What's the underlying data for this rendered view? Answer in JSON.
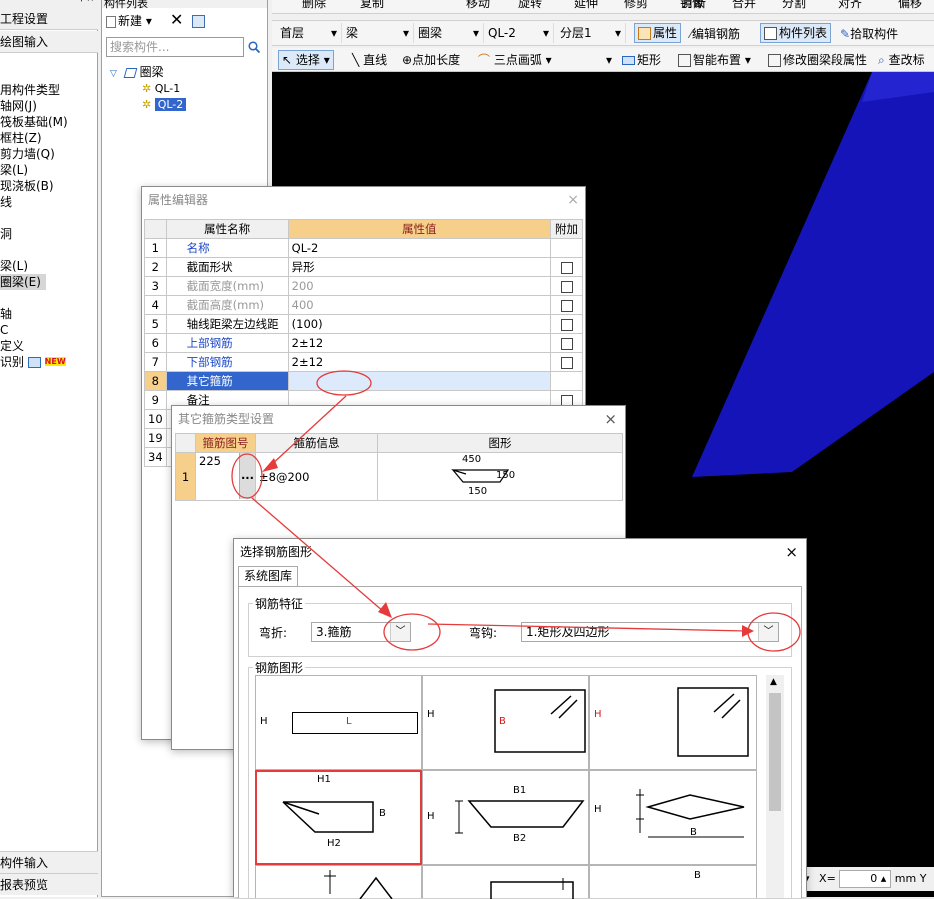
{
  "left_nav": {
    "pin_glyphs": "† ×",
    "items": [
      "工程设置",
      "绘图输入"
    ],
    "tree": [
      "用构件类型",
      "轴网(J)",
      "筏板基础(M)",
      "框柱(Z)",
      "剪力墙(Q)",
      "梁(L)",
      "现浇板(B)",
      "线",
      "",
      "洞",
      "",
      "梁(L)",
      "圈梁(E)",
      "",
      "轴",
      "C",
      "定义",
      "识别"
    ],
    "new_badge": "NEW",
    "bottom": [
      "构件输入",
      "报表预览"
    ]
  },
  "component_list": {
    "title": "构件列表",
    "new_label": "新建",
    "search_placeholder": "搜索构件...",
    "root": "圈梁",
    "children": [
      "QL-1",
      "QL-2"
    ]
  },
  "toolbar1": {
    "items": [
      "删除",
      "复制",
      "镜像",
      "移动",
      "旋转",
      "延伸",
      "修剪",
      "打断",
      "合并",
      "分割",
      "对齐",
      "偏移"
    ]
  },
  "toolbar2": {
    "floor": "首层",
    "type": "梁",
    "subtype": "圈梁",
    "component": "QL-2",
    "layer": "分层1",
    "buttons": [
      "属性",
      "编辑钢筋",
      "构件列表",
      "拾取构件"
    ]
  },
  "toolbar3": {
    "items": [
      "选择",
      "直线",
      "点加长度",
      "三点画弧",
      "矩形",
      "智能布置",
      "修改圈梁段属性",
      "查改标"
    ]
  },
  "property_editor": {
    "title": "属性编辑器",
    "close": "×",
    "headers": [
      "属性名称",
      "属性值",
      "附加"
    ],
    "rows": [
      {
        "num": "1",
        "name": "名称",
        "value": "QL-2"
      },
      {
        "num": "2",
        "name": "截面形状",
        "value": "异形"
      },
      {
        "num": "3",
        "name": "截面宽度(mm)",
        "value": "200"
      },
      {
        "num": "4",
        "name": "截面高度(mm)",
        "value": "400"
      },
      {
        "num": "5",
        "name": "轴线距梁左边线距",
        "value": "(100)"
      },
      {
        "num": "6",
        "name": "上部钢筋",
        "value": "2±12"
      },
      {
        "num": "7",
        "name": "下部钢筋",
        "value": "2±12"
      },
      {
        "num": "8",
        "name": "其它箍筋",
        "value": ""
      },
      {
        "num": "9",
        "name": "备注",
        "value": ""
      },
      {
        "num": "10",
        "name": "",
        "value": ""
      },
      {
        "num": "19",
        "name": "",
        "value": ""
      },
      {
        "num": "34",
        "name": "",
        "value": ""
      }
    ],
    "new_button": "新建"
  },
  "stirrup_dialog": {
    "title": "其它箍筋类型设置",
    "close": "×",
    "headers": [
      "箍筋图号",
      "箍筋信息",
      "图形"
    ],
    "row": {
      "num": "1",
      "code": "225",
      "ellipsis": "...",
      "info": "±8@200"
    },
    "dims": {
      "top": "450",
      "right": "150",
      "bottom": "150"
    }
  },
  "rebar_dialog": {
    "title": "选择钢筋图形",
    "close": "×",
    "tab": "系统图库",
    "feature_group": "钢筋特征",
    "bend_label": "弯折:",
    "bend_value": "3.箍筋",
    "hook_label": "弯钩:",
    "hook_value": "1.矩形及四边形",
    "shape_group": "钢筋图形",
    "shape_labels": {
      "h": "H",
      "l": "L",
      "b": "B",
      "h1": "H1",
      "h2": "H2",
      "b1": "B1",
      "b2": "B2"
    }
  },
  "status": {
    "x_label": "X=",
    "x_value": "0",
    "unit": "mm",
    "y_label": "Y"
  },
  "colors": {
    "accent_orange": "#f6d08a",
    "selection_blue": "#3366cc",
    "highlight_red": "#e53b3b",
    "canvas_shape": "#1414b8"
  }
}
